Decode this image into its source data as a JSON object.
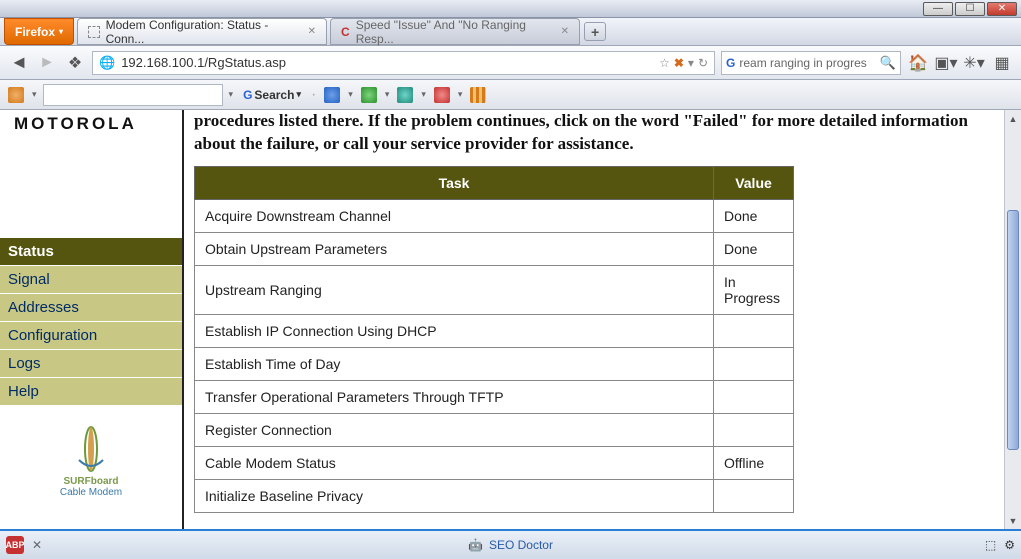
{
  "window": {
    "menuLabel": "Firefox"
  },
  "tabs": [
    {
      "title": "Modem Configuration: Status - Conn...",
      "active": true
    },
    {
      "title": "Speed \"Issue\" And \"No Ranging Resp...",
      "active": false
    }
  ],
  "url": "192.168.100.1/RgStatus.asp",
  "searchBox": {
    "query": "ream ranging in progres"
  },
  "toolbar": {
    "searchLabel": "Search"
  },
  "brand": "MOTOROLA",
  "sidebar": {
    "items": [
      {
        "label": "Status",
        "active": true
      },
      {
        "label": "Signal"
      },
      {
        "label": "Addresses"
      },
      {
        "label": "Configuration"
      },
      {
        "label": "Logs"
      },
      {
        "label": "Help"
      }
    ],
    "productLine1": "SURFboard",
    "productLine2": "Cable Modem"
  },
  "introText": "procedures listed there. If the problem continues, click on the word \"Failed\" for more detailed information about the failure, or call your service provider for assistance.",
  "tableHeaders": {
    "task": "Task",
    "value": "Value"
  },
  "tasks": [
    {
      "task": "Acquire Downstream Channel",
      "value": "Done"
    },
    {
      "task": "Obtain Upstream Parameters",
      "value": "Done"
    },
    {
      "task": "Upstream Ranging",
      "value": "In Progress"
    },
    {
      "task": "Establish IP Connection Using DHCP",
      "value": ""
    },
    {
      "task": "Establish Time of Day",
      "value": ""
    },
    {
      "task": "Transfer Operational Parameters Through TFTP",
      "value": ""
    },
    {
      "task": "Register Connection",
      "value": ""
    },
    {
      "task": "Cable Modem Status",
      "value": "Offline"
    },
    {
      "task": "Initialize Baseline Privacy",
      "value": ""
    }
  ],
  "statusbar": {
    "seoLabel": "SEO Doctor"
  }
}
